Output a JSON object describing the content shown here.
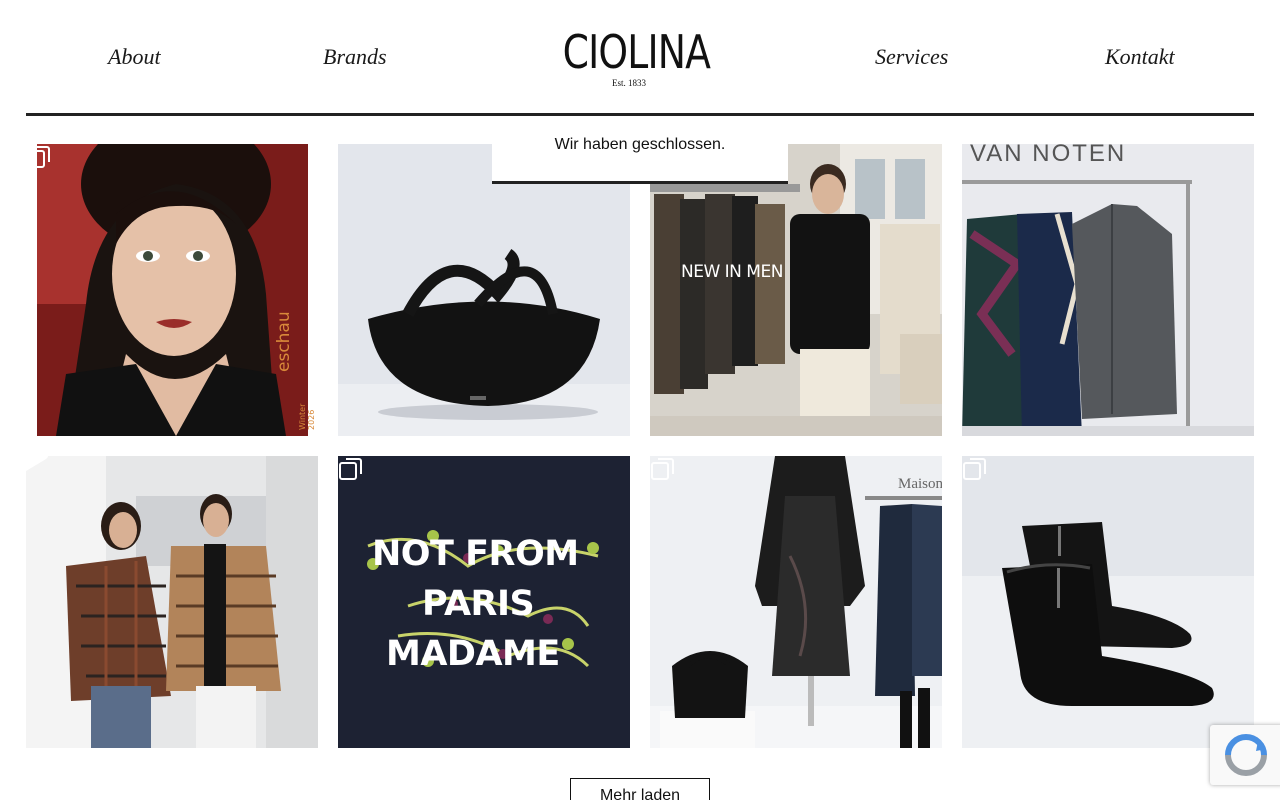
{
  "nav": {
    "about": "About",
    "brands": "Brands",
    "services": "Services",
    "kontakt": "Kontakt"
  },
  "logo": {
    "name": "CIOLINA",
    "tagline": "Est. 1833"
  },
  "notice": {
    "text": "Wir haben geschlossen."
  },
  "feed": {
    "posts": [
      {
        "kind": "carousel",
        "cover_text": "eschau",
        "cover_subtext": "Winter 2026"
      },
      {
        "kind": "image"
      },
      {
        "kind": "video",
        "overlay_text": "NEW IN MEN"
      },
      {
        "kind": "image",
        "sign_text": "VAN NOTEN"
      },
      {
        "kind": "video"
      },
      {
        "kind": "carousel",
        "line1": "NOT FROM",
        "line2": "PARIS",
        "line3": "MADAME"
      },
      {
        "kind": "carousel",
        "sign_text": "Maison"
      },
      {
        "kind": "carousel"
      }
    ]
  },
  "load_more": {
    "label": "Mehr laden"
  },
  "colors": {
    "rule": "#222222",
    "text": "#111111",
    "poster_bg": "#1d2233"
  }
}
